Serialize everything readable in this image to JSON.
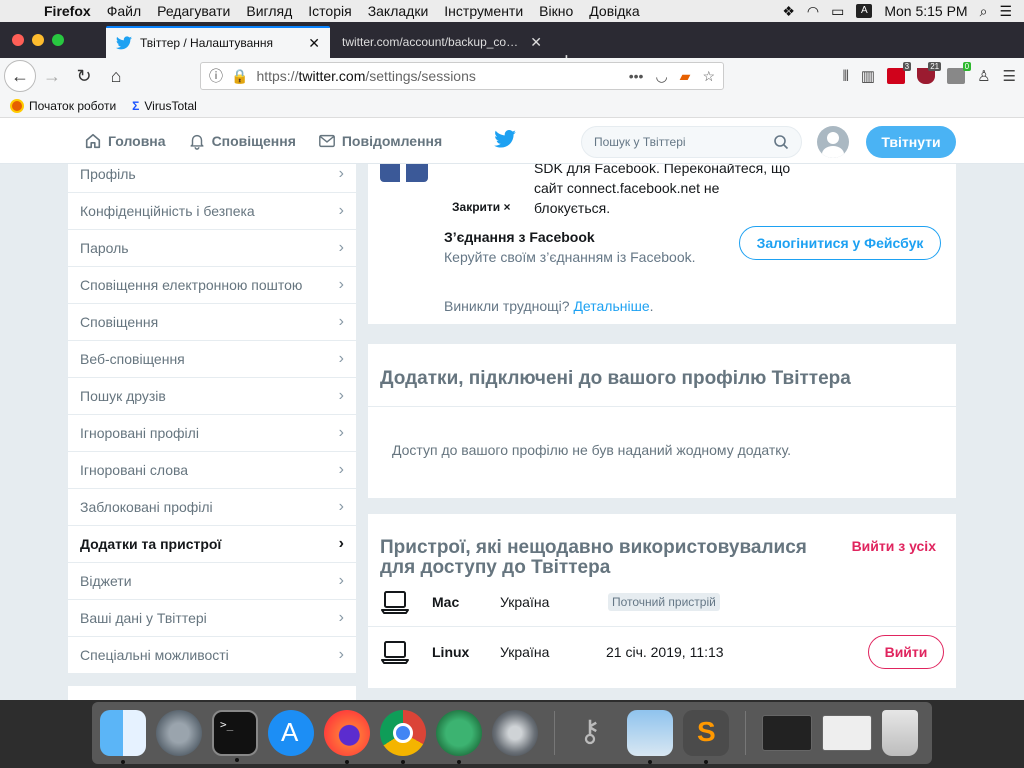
{
  "menubar": {
    "app": "Firefox",
    "items": [
      "Файл",
      "Редагувати",
      "Вигляд",
      "Історія",
      "Закладки",
      "Інструменти",
      "Вікно",
      "Довідка"
    ],
    "clock": "Mon 5:15 PM",
    "input_source": "A"
  },
  "tabs": [
    {
      "title": "Твіттер / Налаштування",
      "active": true
    },
    {
      "title": "twitter.com/account/backup_code/p",
      "active": false
    }
  ],
  "urlbar": {
    "scheme": "https://",
    "host": "twitter.com",
    "path": "/settings/sessions"
  },
  "toolbar": {
    "badges": [
      "3",
      "21",
      "0"
    ]
  },
  "bookmarks": [
    {
      "label": "Початок роботи",
      "icon": "firefox-icon"
    },
    {
      "label": "VirusTotal",
      "icon": "virustotal-icon"
    }
  ],
  "twitter_header": {
    "home": "Головна",
    "notifications": "Сповіщення",
    "messages": "Повідомлення",
    "search_placeholder": "Пошук у Твіттері",
    "tweet": "Твітнути"
  },
  "settings_menu": [
    {
      "label": "Профіль",
      "active": false
    },
    {
      "label": "Конфіденційність і безпека",
      "active": false
    },
    {
      "label": "Пароль",
      "active": false
    },
    {
      "label": "Сповіщення електронною поштою",
      "active": false
    },
    {
      "label": "Сповіщення",
      "active": false
    },
    {
      "label": "Веб-сповіщення",
      "active": false
    },
    {
      "label": "Пошук друзів",
      "active": false
    },
    {
      "label": "Ігноровані профілі",
      "active": false
    },
    {
      "label": "Ігноровані слова",
      "active": false
    },
    {
      "label": "Заблоковані профілі",
      "active": false
    },
    {
      "label": "Додатки та пристрої",
      "active": true
    },
    {
      "label": "Віджети",
      "active": false
    },
    {
      "label": "Ваші дані у Твіттері",
      "active": false
    },
    {
      "label": "Спеціальні можливості",
      "active": false
    }
  ],
  "facebook": {
    "close": "Закрити ×",
    "note_line1": "SDK для Facebook. Переконайтеся, що",
    "note_line2": "сайт connect.facebook.net не",
    "note_line3": "блокується.",
    "title": "З’єднання з Facebook",
    "description": "Керуйте своїм з’єднанням із Facebook.",
    "button": "Залогінитися у Фейсбук",
    "help_prefix": "Виникли труднощі?",
    "help_link": "Детальніше",
    "help_suffix": "."
  },
  "apps": {
    "title": "Додатки, підключені до вашого профілю Твіттера",
    "empty": "Доступ до вашого профілю не був наданий жодному додатку."
  },
  "devices": {
    "title": "Пристрої, які нещодавно використовувалися для доступу до Твіттера",
    "logout_all": "Вийти з усіх",
    "rows": [
      {
        "name": "Mac",
        "location": "Україна",
        "status": "Поточний пристрій"
      },
      {
        "name": "Linux",
        "location": "Україна",
        "date": "21 січ. 2019, 11:13",
        "action": "Вийти"
      }
    ]
  },
  "colors": {
    "twitter_blue": "#1da1f2",
    "tweet_button": "#4ab3f4",
    "logout_red": "#e0245e",
    "facebook_blue": "#3b5998"
  }
}
